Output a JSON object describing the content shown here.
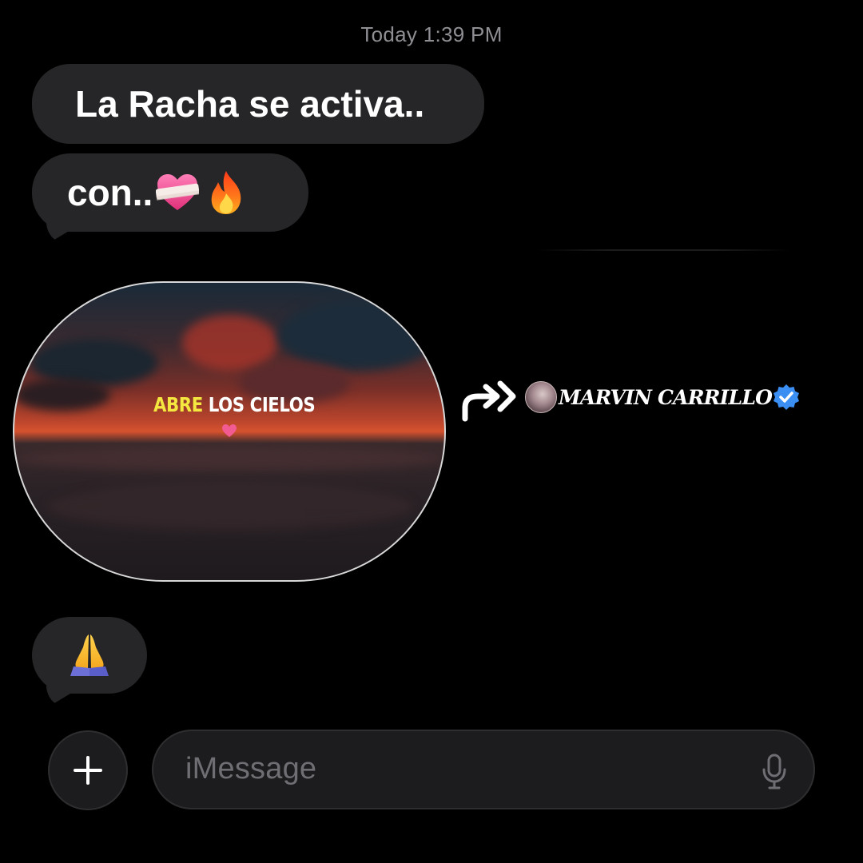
{
  "timestamp": "Today 1:39 PM",
  "messages": [
    {
      "text": "La Racha se activa..",
      "emoji": []
    },
    {
      "text": "con..",
      "emoji": [
        "heart-with-bandage",
        "fire"
      ]
    },
    {
      "text": "",
      "emoji": [
        "folded-hands"
      ]
    }
  ],
  "video": {
    "caption_highlight": "ABRE",
    "caption_rest": "LOS CIELOS",
    "caption_highlight_color": "#f3e740"
  },
  "profile": {
    "name": "MARVIN CARRILLO",
    "verified": true,
    "verified_color": "#3b8ff3"
  },
  "composer": {
    "placeholder": "iMessage"
  },
  "colors": {
    "background": "#000000",
    "bubble": "#262628",
    "input_background": "#1c1c1e",
    "placeholder": "#6e6e73"
  }
}
